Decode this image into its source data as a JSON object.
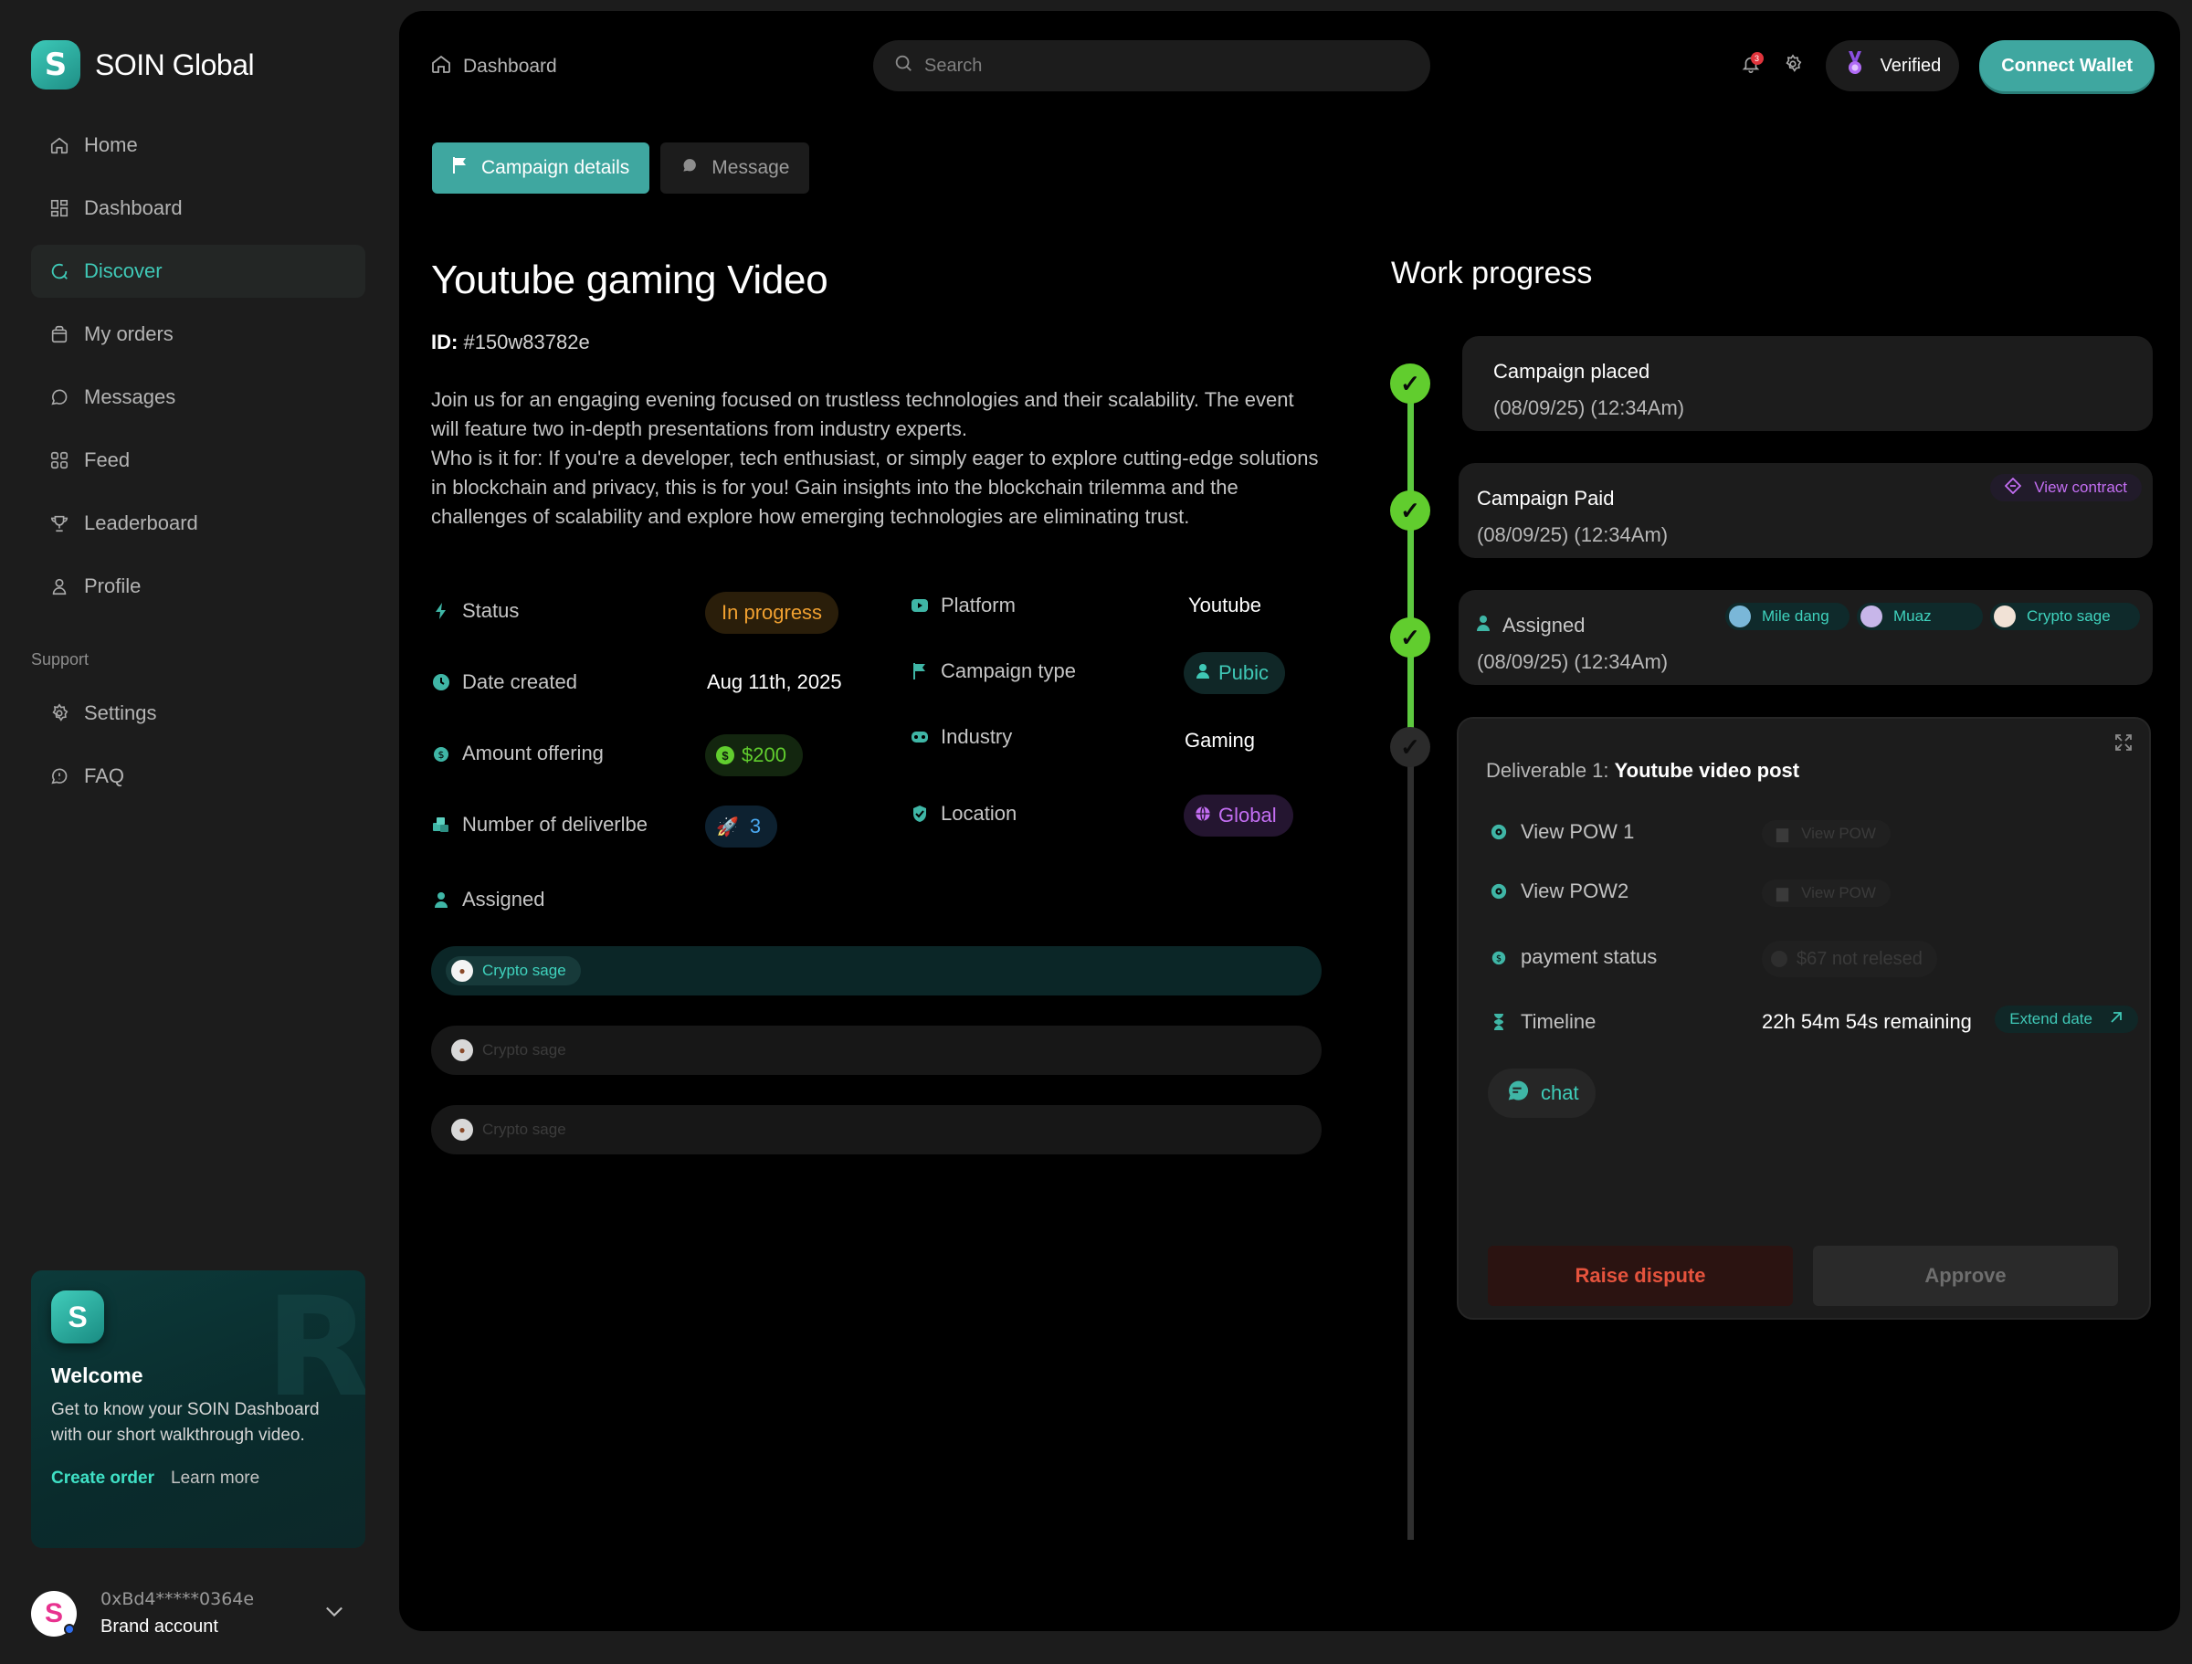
{
  "app": {
    "name": "SOIN Global"
  },
  "sidebar": {
    "items": [
      {
        "label": "Home",
        "icon": "home-icon"
      },
      {
        "label": "Dashboard",
        "icon": "grid-icon"
      },
      {
        "label": "Discover",
        "icon": "discover-icon",
        "active": true
      },
      {
        "label": "My orders",
        "icon": "bag-icon"
      },
      {
        "label": "Messages",
        "icon": "chat-icon"
      },
      {
        "label": "Feed",
        "icon": "feed-icon"
      },
      {
        "label": "Leaderboard",
        "icon": "trophy-icon"
      },
      {
        "label": "Profile",
        "icon": "user-icon"
      }
    ],
    "support_label": "Support",
    "support_items": [
      {
        "label": "Settings",
        "icon": "gear-icon"
      },
      {
        "label": "FAQ",
        "icon": "faq-icon"
      }
    ],
    "welcome": {
      "title": "Welcome",
      "text": "Get to know your SOIN Dashboard with our short walkthrough video.",
      "create_order": "Create order",
      "learn_more": "Learn more"
    },
    "account": {
      "address": "0xBd4*****0364e",
      "name": "Brand account"
    }
  },
  "header": {
    "breadcrumb": "Dashboard",
    "search_placeholder": "Search",
    "notification_count": "3",
    "verified_label": "Verified",
    "connect_label": "Connect Wallet"
  },
  "tabs": [
    {
      "label": "Campaign details",
      "active": true
    },
    {
      "label": "Message",
      "active": false
    }
  ],
  "campaign": {
    "title": "Youtube gaming  Video",
    "id_label": "ID:",
    "id_value": "#150w83782e",
    "description": "Join us for an engaging evening focused on trustless technologies and their scalability. The event will feature two in-depth presentations from industry experts.\nWho is it for: If you're a developer, tech enthusiast, or simply eager to explore cutting-edge solutions in blockchain and privacy, this is for you! Gain insights into the blockchain trilemma and the challenges of scalability and explore how emerging technologies are eliminating trust.",
    "left_details": [
      {
        "label": "Status",
        "value": "In progress"
      },
      {
        "label": "Date created",
        "value": "Aug 11th, 2025"
      },
      {
        "label": "Amount offering",
        "value": "$200"
      },
      {
        "label": "Number of deliverlbe",
        "value": "3"
      }
    ],
    "right_details": [
      {
        "label": "Platform",
        "value": "Youtube"
      },
      {
        "label": "Campaign type",
        "value": "Pubic"
      },
      {
        "label": "Industry",
        "value": "Gaming"
      },
      {
        "label": "Location",
        "value": "Global"
      }
    ],
    "assigned_label": "Assigned",
    "assigned_rows": [
      "Crypto sage",
      "Crypto sage",
      "Crypto sage"
    ]
  },
  "work_progress": {
    "title": "Work progress",
    "steps": [
      {
        "title": "Campaign placed",
        "time": "(08/09/25) (12:34Am)"
      },
      {
        "title": "Campaign Paid",
        "time": "(08/09/25) (12:34Am)",
        "action": "View contract"
      },
      {
        "title": "Assigned",
        "time": "(08/09/25) (12:34Am)",
        "people": [
          "Mile dang",
          "Muaz",
          "Crypto sage"
        ]
      }
    ],
    "deliverable": {
      "label": "Deliverable 1:",
      "name": "Youtube video  post",
      "rows": [
        {
          "label": "View POW 1",
          "value": "View POW"
        },
        {
          "label": "View POW2",
          "value": "View POW"
        },
        {
          "label": "payment status",
          "value": "$67 not relesed"
        },
        {
          "label": "Timeline",
          "value": "22h 54m 54s remaining",
          "action": "Extend date"
        }
      ],
      "chat_label": "chat",
      "dispute_label": "Raise dispute",
      "approve_label": "Approve"
    }
  },
  "colors": {
    "accent": "#3fa7a0",
    "teal_text": "#3fc8b6",
    "progress_green": "#61cd2e",
    "status_orange": "#f0a030",
    "purple": "#c36ef2",
    "dispute_red": "#e5533d"
  }
}
